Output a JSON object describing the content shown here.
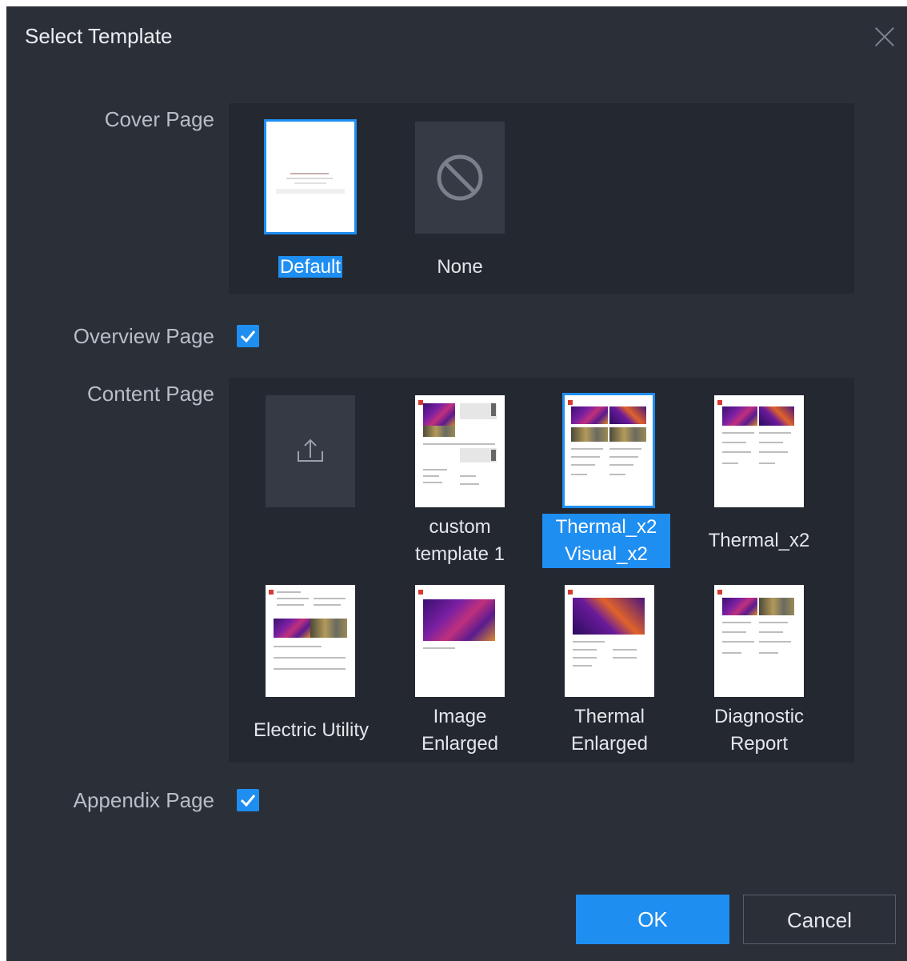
{
  "dialog": {
    "title": "Select Template",
    "close_icon": "close-icon"
  },
  "cover": {
    "label": "Cover Page",
    "options": [
      {
        "label": "Default",
        "selected": true
      },
      {
        "label": "None",
        "selected": false,
        "icon": "none-icon"
      }
    ]
  },
  "overview": {
    "label": "Overview Page",
    "checked": true
  },
  "content": {
    "label": "Content Page",
    "upload_icon": "upload-icon",
    "templates": [
      {
        "line1": "custom",
        "line2": "template 1",
        "selected": false
      },
      {
        "line1": "Thermal_x2",
        "line2": "Visual_x2",
        "selected": true
      },
      {
        "line1": "Thermal_x2",
        "line2": "",
        "selected": false
      },
      {
        "line1": "Electric Utility",
        "line2": "",
        "selected": false
      },
      {
        "line1": "Image",
        "line2": "Enlarged",
        "selected": false
      },
      {
        "line1": "Thermal",
        "line2": "Enlarged",
        "selected": false
      },
      {
        "line1": "Diagnostic",
        "line2": "Report",
        "selected": false
      }
    ]
  },
  "appendix": {
    "label": "Appendix Page",
    "checked": true
  },
  "buttons": {
    "ok": "OK",
    "cancel": "Cancel"
  },
  "colors": {
    "accent": "#1f8ef1",
    "background": "#2b2f38",
    "panel": "#242831"
  }
}
